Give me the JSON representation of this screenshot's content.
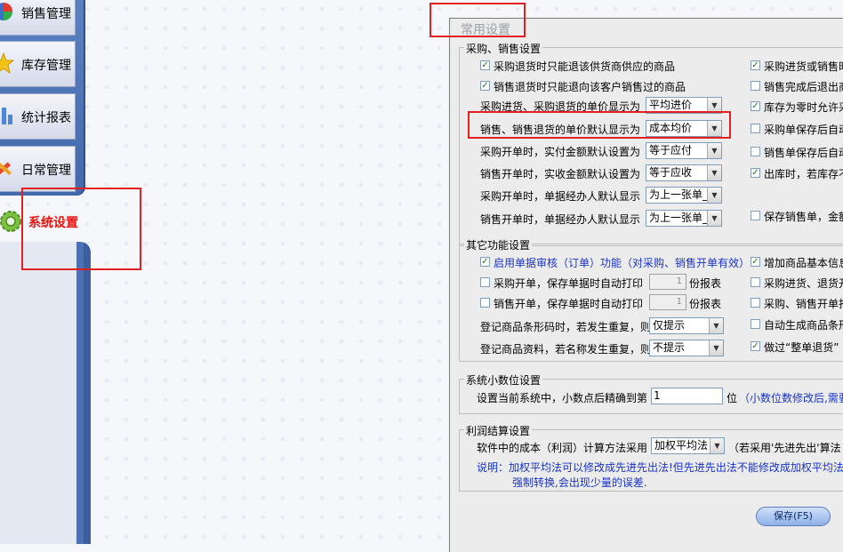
{
  "nav": {
    "items": [
      {
        "label": "销售管理",
        "icon": "sales-chart-icon"
      },
      {
        "label": "库存管理",
        "icon": "inventory-star-icon"
      },
      {
        "label": "统计报表",
        "icon": "statistics-bars-icon"
      },
      {
        "label": "日常管理",
        "icon": "daily-tools-icon"
      }
    ],
    "active": {
      "label": "系统设置",
      "icon": "gear-icon"
    }
  },
  "dialog": {
    "title": "常用设置",
    "purchase_sales": {
      "title": "采购、销售设置",
      "left_checks": [
        {
          "label": "采购退货时只能退该供货商供应的商品",
          "checked": true
        },
        {
          "label": "销售退货时只能退向该客户销售过的商品",
          "checked": true
        }
      ],
      "left_selects": [
        {
          "label": "采购进货、采购退货的单价显示为",
          "value": "平均进价"
        },
        {
          "label": "销售、销售退货的单价默认显示为",
          "value": "成本均价"
        },
        {
          "label": "采购开单时，实付金额默认设置为",
          "value": "等于应付"
        },
        {
          "label": "销售开单时，实收金额默认设置为",
          "value": "等于应收"
        },
        {
          "label": "采购开单时，单据经办人默认显示",
          "value": "为上一张单_"
        },
        {
          "label": "销售开单时，单据经办人默认显示",
          "value": "为上一张单_"
        }
      ],
      "right_checks": [
        {
          "label": "采购进货或销售时",
          "checked": true
        },
        {
          "label": "销售完成后退出商",
          "checked": false
        },
        {
          "label": "库存为零时允许采",
          "checked": true
        },
        {
          "label": "采购单保存后自动",
          "checked": false
        },
        {
          "label": "销售单保存后自动",
          "checked": false
        },
        {
          "label": "出库时，若库存不",
          "checked": true
        },
        {
          "label": "保存销售单，金额",
          "checked": false
        }
      ]
    },
    "other": {
      "title": "其它功能设置",
      "audit": {
        "label": "启用单据审核（订单）功能（对采购、销售开单有效）",
        "checked": true
      },
      "purchase_print": {
        "label": "采购开单，保存单据时自动打印",
        "copies": "1",
        "unit": "份报表",
        "checked": false
      },
      "sales_print": {
        "label": "销售开单，保存单据时自动打印",
        "copies": "1",
        "unit": "份报表",
        "checked": false
      },
      "barcode_dup": {
        "label": "登记商品条形码时，若发生重复，则",
        "value": "仅提示"
      },
      "name_dup": {
        "label": "登记商品资料，若名称发生重复，则",
        "value": "不提示"
      },
      "right_checks": [
        {
          "label": "增加商品基本信息",
          "checked": true
        },
        {
          "label": "采购进货、退货开",
          "checked": false
        },
        {
          "label": "采购、销售开单打",
          "checked": false
        },
        {
          "label": "自动生成商品条形",
          "checked": false
        },
        {
          "label": "做过“整单退货”",
          "checked": true
        }
      ]
    },
    "decimal": {
      "title": "系统小数位设置",
      "label": "设置当前系统中，小数点后精确到第",
      "value": "1",
      "unit": "位",
      "note": "（小数位数修改后,需要"
    },
    "profit": {
      "title": "利润结算设置",
      "label": "软件中的成本（利润）计算方法采用",
      "value": "加权平均法",
      "after": "（若采用'先进先出'算法",
      "note_line1": "说明：加权平均法可以修改成先进先出法!但先进先出法不能修改成加权平均法",
      "note_line2": "强制转换,会出现少量的误差."
    },
    "save_label": "保存(F5)"
  },
  "colors": {
    "annotation_red": "#e32020",
    "active_nav_text": "#e8110e",
    "note_blue": "#1a33c7"
  }
}
